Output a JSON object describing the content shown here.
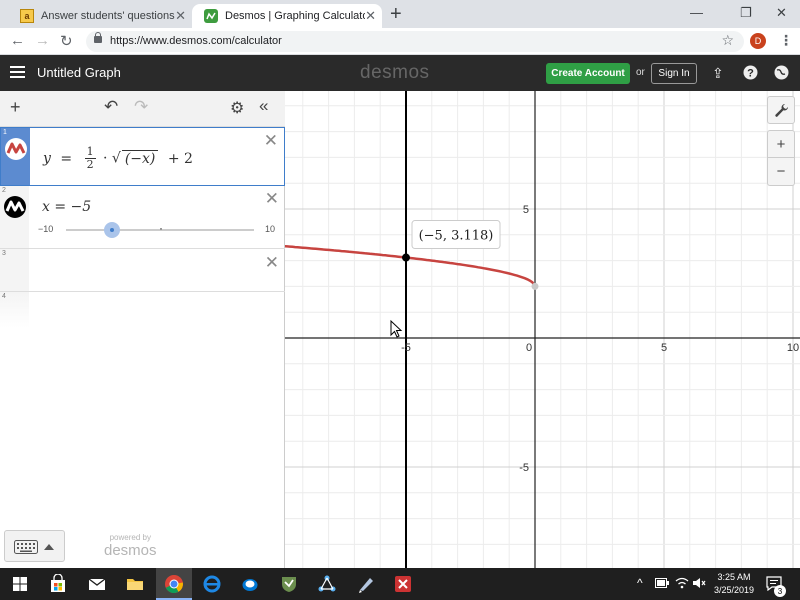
{
  "browser": {
    "tabs": [
      {
        "title": "Answer students' questions and e",
        "active": false
      },
      {
        "title": "Desmos | Graphing Calculator",
        "active": true
      }
    ],
    "url": "https://www.desmos.com/calculator",
    "profile_initial": "D"
  },
  "header": {
    "graph_title": "Untitled Graph",
    "logo": "desmos",
    "create_account": "Create Account",
    "or": "or",
    "sign_in": "Sign In"
  },
  "expressions": [
    {
      "number": "1",
      "lhs": "y",
      "eq": "=",
      "frac_num": "1",
      "frac_den": "2",
      "dot": "·",
      "radicand": "(−x)",
      "tail": "+ 2",
      "color": "#c74440"
    },
    {
      "number": "2",
      "text": "x = −5",
      "color": "#000000",
      "slider": {
        "min": "−10",
        "max": "10",
        "value": -5
      }
    },
    {
      "number": "3"
    },
    {
      "number": "4"
    }
  ],
  "footer": {
    "powered_by": "powered by",
    "brand": "desmos"
  },
  "graph": {
    "x_ticks": [
      {
        "value": -5,
        "label": "-5"
      },
      {
        "value": 0,
        "label": "0"
      },
      {
        "value": 5,
        "label": "5"
      },
      {
        "value": 10,
        "label": "10"
      }
    ],
    "y_ticks": [
      {
        "value": 5,
        "label": "5"
      },
      {
        "value": -5,
        "label": "-5"
      }
    ],
    "point_label": "(−5, 3.118)",
    "curve_color": "#c74440",
    "vertical_line_x": -5
  },
  "taskbar": {
    "time": "3:25 AM",
    "date": "3/25/2019",
    "notifications": "3"
  }
}
